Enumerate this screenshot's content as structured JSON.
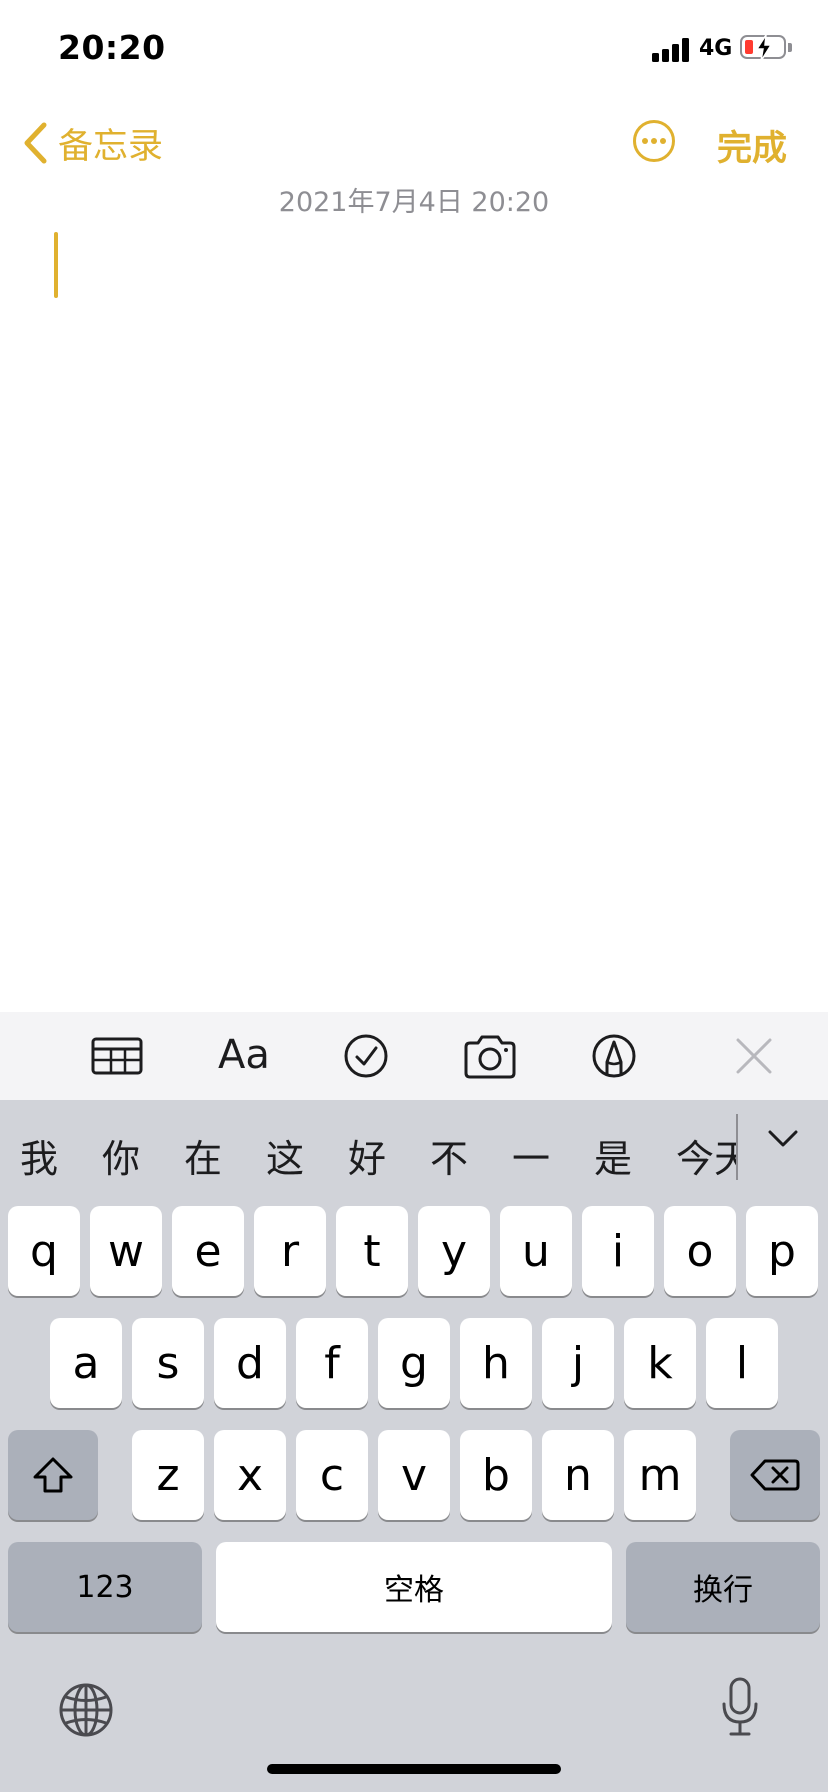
{
  "status_bar": {
    "time": "20:20",
    "network": "4G",
    "battery_level_fraction": 0.15,
    "battery_color": "#ff3b30",
    "charging": true
  },
  "nav": {
    "back_label": "备忘录",
    "more_icon": "ellipsis-circle-icon",
    "done_label": "完成",
    "accent_color": "#e0b12f"
  },
  "note": {
    "date": "2021年7月4日 20:20",
    "body": ""
  },
  "toolbar": {
    "items": [
      "table-icon",
      "Aa",
      "checklist-icon",
      "camera-icon",
      "markup-pen-icon",
      "close-icon"
    ],
    "format_label": "Aa"
  },
  "keyboard": {
    "candidates": [
      "我",
      "你",
      "在",
      "这",
      "好",
      "不",
      "一",
      "是",
      "今天"
    ],
    "rows": [
      [
        "q",
        "w",
        "e",
        "r",
        "t",
        "y",
        "u",
        "i",
        "o",
        "p"
      ],
      [
        "a",
        "s",
        "d",
        "f",
        "g",
        "h",
        "j",
        "k",
        "l"
      ],
      [
        "z",
        "x",
        "c",
        "v",
        "b",
        "n",
        "m"
      ]
    ],
    "numbers_label": "123",
    "space_label": "空格",
    "return_label": "换行",
    "shift_icon": "shift-icon",
    "delete_icon": "delete-icon",
    "globe_icon": "globe-icon",
    "mic_icon": "microphone-icon"
  }
}
